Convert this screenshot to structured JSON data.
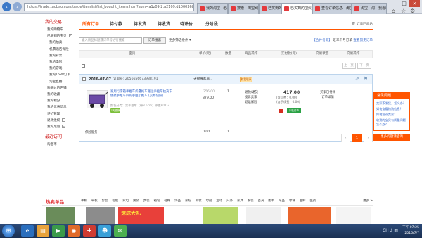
{
  "browser": {
    "address": "https://trade.taobao.com/trade/itemlist/list_bought_items.htm?spm=a1z09.2.a2109.d1000368.9Lrx...",
    "tabs": [
      {
        "label": "我的淘宝 - 已买到的宝贝",
        "active": false
      },
      {
        "label": "搜索 - 淘宝网",
        "active": false
      },
      {
        "label": "已买到的",
        "active": false
      },
      {
        "label": "已买到的宝贝",
        "active": true
      },
      {
        "label": "查看订单信息 - 淘宝",
        "active": false
      },
      {
        "label": "淘宝 - 淘！我喜欢",
        "active": false
      }
    ],
    "back_icon": "back-arrow-icon",
    "forward_icon": "forward-arrow-icon"
  },
  "sidebar": {
    "heading": "我的交易",
    "items": [
      {
        "label": "我的购物车",
        "sub": false
      },
      {
        "label": "已买到的宝贝",
        "sub": false,
        "expand": true
      },
      {
        "label": "我的拍卖",
        "sub": true
      },
      {
        "label": "机票酒店保险",
        "sub": true
      },
      {
        "label": "我的彩票",
        "sub": true
      },
      {
        "label": "我的电影",
        "sub": true
      },
      {
        "label": "我的游戏",
        "sub": true
      },
      {
        "label": "我的1688订单",
        "sub": true
      },
      {
        "label": "淘宝直播",
        "sub": true
      },
      {
        "label": "购买过的店铺",
        "sub": false
      },
      {
        "label": "我的收藏",
        "sub": false
      },
      {
        "label": "我的积分",
        "sub": false
      },
      {
        "label": "我的优惠信息",
        "sub": false
      },
      {
        "label": "评价管理",
        "sub": false
      },
      {
        "label": "退款维权",
        "sub": false,
        "expand": true
      },
      {
        "label": "我的足迹",
        "sub": false,
        "expand": true
      }
    ],
    "recent_heading": "最近访问",
    "recent_items": [
      "淘金币"
    ]
  },
  "main": {
    "tabs": [
      {
        "label": "所有订单",
        "active": true
      },
      {
        "label": "待付款",
        "active": false
      },
      {
        "label": "待发货",
        "active": false
      },
      {
        "label": "待收货",
        "active": false
      },
      {
        "label": "待评价",
        "active": false
      },
      {
        "label": "分阶段",
        "active": false
      }
    ],
    "recycle_label": "订单回收站",
    "search": {
      "placeholder": "输入商品标题或订单号进行搜索",
      "button_label": "订单搜索",
      "more_filter_label": "更多筛选条件"
    },
    "recent_opts": {
      "merge_label": "合并付款",
      "recent_label": "近三个月订单",
      "history_label": "查看历史订单"
    },
    "columns": [
      "宝贝",
      "单价(元)",
      "数量",
      "商品操作",
      "实付款(元)",
      "交易状态",
      "交易操作"
    ],
    "mini_pager": {
      "prev": "上一页",
      "next": "下一页"
    },
    "order": {
      "date": "2016-07-07",
      "order_no_label": "订单号:",
      "order_no": "2056656673938191",
      "seller": "天锐展家居...",
      "contact_label": "和我联系",
      "item": {
        "title": "家用行李箱手推车折叠拖车搬运手推车拉货车便携手推车四轮手推小推车 [交易快照]",
        "attr": "颜色分类：黑手推车（带3.5cm）承重80KG",
        "tag": "7天退换",
        "price_old": "256.00",
        "price_new": "379.00",
        "qty": "1",
        "ops": [
          "退款/退货",
          "投诉卖家",
          "退运保险"
        ]
      },
      "payment": {
        "total": "417.00",
        "line1": "(含运费：0.00)",
        "line2": "(含手续费：0.00)",
        "badge": "手机订单"
      },
      "status": [
        "买家已付款",
        "订单详情"
      ],
      "insurance": {
        "label": "保险服务",
        "price": "0.00",
        "qty": "1"
      }
    },
    "pagination": {
      "prev": "上一页",
      "current": "1",
      "next": "下一页"
    }
  },
  "help": {
    "title": "常见问题",
    "questions": [
      "卖家不发货，怎么办？",
      "如何查看物流信息？",
      "如何投诉卖家？",
      "收到的宝贝有质量问题怎么办？"
    ],
    "more_label": "更多问题请咨询"
  },
  "hot": {
    "title": "热卖单品",
    "categories": [
      "手机",
      "平板",
      "影音",
      "智能",
      "家电",
      "男装",
      "女装",
      "箱包",
      "鞋靴",
      "饰品",
      "家纺",
      "美妆",
      "母婴",
      "运动",
      "户外",
      "家具",
      "家装",
      "百货",
      "图书",
      "车品",
      "零食",
      "生鲜",
      "医药"
    ],
    "more_label": "更多 >",
    "promo_text": "速成大礼"
  },
  "taskbar": {
    "time": "下午 07:25",
    "date": "2016/7/7",
    "tray": "CH"
  }
}
